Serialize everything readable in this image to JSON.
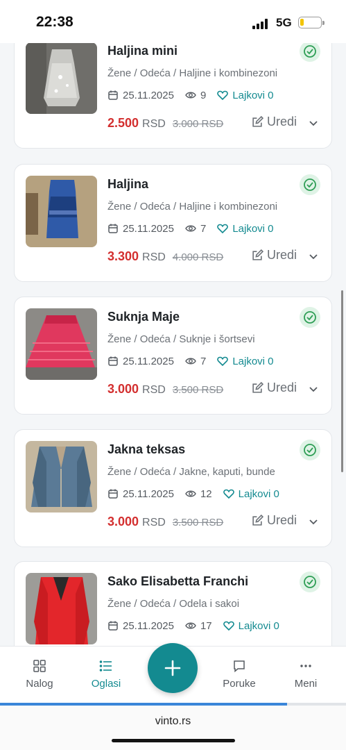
{
  "status_bar": {
    "time": "22:38",
    "network": "5G"
  },
  "listings": [
    {
      "title": "Haljina mini",
      "category": "Žene / Odeća / Haljine i kombinezoni",
      "date": "25.11.2025",
      "views": "9",
      "likes": "Lajkovi 0",
      "price": "2.500",
      "currency": "RSD",
      "old_price": "3.000 RSD",
      "edit_label": "Uredi",
      "thumb_color": "#8e8e8c"
    },
    {
      "title": "Haljina",
      "category": "Žene / Odeća / Haljine i kombinezoni",
      "date": "25.11.2025",
      "views": "7",
      "likes": "Lajkovi 0",
      "price": "3.300",
      "currency": "RSD",
      "old_price": "4.000 RSD",
      "edit_label": "Uredi",
      "thumb_color": "#2f5aa8"
    },
    {
      "title": "Suknja Maje",
      "category": "Žene / Odeća / Suknje i šortsevi",
      "date": "25.11.2025",
      "views": "7",
      "likes": "Lajkovi 0",
      "price": "3.000",
      "currency": "RSD",
      "old_price": "3.500 RSD",
      "edit_label": "Uredi",
      "thumb_color": "#e0385e"
    },
    {
      "title": "Jakna teksas",
      "category": "Žene / Odeća / Jakne, kaputi, bunde",
      "date": "25.11.2025",
      "views": "12",
      "likes": "Lajkovi 0",
      "price": "3.000",
      "currency": "RSD",
      "old_price": "3.500 RSD",
      "edit_label": "Uredi",
      "thumb_color": "#5a7a96"
    },
    {
      "title": "Sako Elisabetta Franchi",
      "category": "Žene / Odeća / Odela i sakoi",
      "date": "25.11.2025",
      "views": "17",
      "likes": "Lajkovi 0",
      "price": "",
      "currency": "",
      "old_price": "",
      "edit_label": "",
      "thumb_color": "#e3262b"
    }
  ],
  "bottom_nav": {
    "items": [
      {
        "label": "Nalog",
        "icon": "grid-icon"
      },
      {
        "label": "Oglasi",
        "icon": "list-icon",
        "active": true
      },
      {
        "label": "Poruke",
        "icon": "chat-icon"
      },
      {
        "label": "Meni",
        "icon": "more-icon"
      }
    ],
    "fab_icon": "plus-icon"
  },
  "page_load_progress": 0.83,
  "browser": {
    "url": "vinto.rs"
  },
  "colors": {
    "accent": "#138a90",
    "price": "#d32f2f",
    "active_badge": "#2e9e55"
  }
}
